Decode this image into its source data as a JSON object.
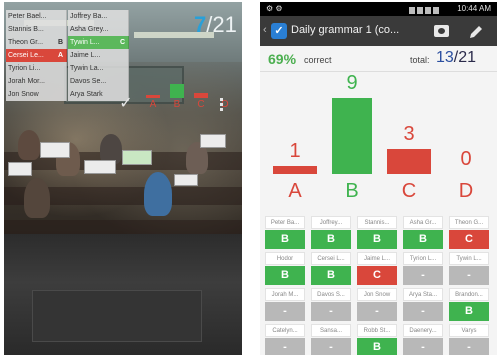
{
  "left_phone": {
    "score": {
      "value": "7",
      "total": "/21"
    },
    "students": [
      {
        "name": "Peter Bael...",
        "state": "none",
        "mark": ""
      },
      {
        "name": "Joffrey Ba...",
        "state": "none",
        "mark": ""
      },
      {
        "name": "Stannis B...",
        "state": "none",
        "mark": ""
      },
      {
        "name": "Asha Grey...",
        "state": "none",
        "mark": ""
      },
      {
        "name": "Theon Gr...",
        "state": "none",
        "mark": "B"
      },
      {
        "name": "Tywin L...",
        "state": "green",
        "mark": "C"
      },
      {
        "name": "Cersei Le...",
        "state": "red",
        "mark": "A"
      },
      {
        "name": "Jaime L...",
        "state": "none",
        "mark": ""
      },
      {
        "name": "Tyrion Li...",
        "state": "none",
        "mark": ""
      },
      {
        "name": "Tywin La...",
        "state": "none",
        "mark": ""
      },
      {
        "name": "Jorah Mor...",
        "state": "none",
        "mark": ""
      },
      {
        "name": "Davos Se...",
        "state": "none",
        "mark": ""
      },
      {
        "name": "Jon Snow",
        "state": "none",
        "mark": ""
      },
      {
        "name": "Arya Stark",
        "state": "none",
        "mark": ""
      }
    ],
    "mini_chart_labels": [
      "A",
      "B",
      "C",
      "D"
    ],
    "buttons": {
      "confirm_icon": "check-icon",
      "menu_icon": "kebab-menu-icon"
    }
  },
  "right_phone": {
    "status_bar": {
      "left": "⚙ ⚙",
      "time": "10:44 AM"
    },
    "action_bar": {
      "back": "‹",
      "app_icon_glyph": "✓",
      "title": "Daily grammar 1 (co...",
      "camera_icon": "camera-icon",
      "edit_icon": "pencil-icon"
    },
    "summary": {
      "percent": "69%",
      "percent_label": "correct",
      "total_label": "total:",
      "total_value": "13",
      "total_suffix": "/21"
    },
    "colors": {
      "correct": "#3fb34f",
      "incorrect": "#d9473b",
      "unanswered": "#b8b8b8"
    },
    "students": [
      {
        "name": "Peter Ba...",
        "answer": "B"
      },
      {
        "name": "Joffrey...",
        "answer": "B"
      },
      {
        "name": "Stannis...",
        "answer": "B"
      },
      {
        "name": "Asha Gr...",
        "answer": "B"
      },
      {
        "name": "Theon G...",
        "answer": "C"
      },
      {
        "name": "Hodor",
        "answer": "B"
      },
      {
        "name": "Cersei L...",
        "answer": "B"
      },
      {
        "name": "Jaime L...",
        "answer": "C"
      },
      {
        "name": "Tyrion L...",
        "answer": "-"
      },
      {
        "name": "Tywin L...",
        "answer": "-"
      },
      {
        "name": "Jorah M...",
        "answer": "-"
      },
      {
        "name": "Davos S...",
        "answer": "-"
      },
      {
        "name": "Jon Snow",
        "answer": "-"
      },
      {
        "name": "Arya Sta...",
        "answer": "-"
      },
      {
        "name": "Brandon...",
        "answer": "B"
      },
      {
        "name": "Catelyn...",
        "answer": "-"
      },
      {
        "name": "Sansa...",
        "answer": "-"
      },
      {
        "name": "Robb St...",
        "answer": "B"
      },
      {
        "name": "Daenery...",
        "answer": "-"
      },
      {
        "name": "Varys",
        "answer": "-"
      }
    ]
  },
  "chart_data": {
    "type": "bar",
    "categories": [
      "A",
      "B",
      "C",
      "D"
    ],
    "values": [
      1,
      9,
      3,
      0
    ],
    "correct_category": "B",
    "title": "",
    "xlabel": "",
    "ylabel": ""
  }
}
